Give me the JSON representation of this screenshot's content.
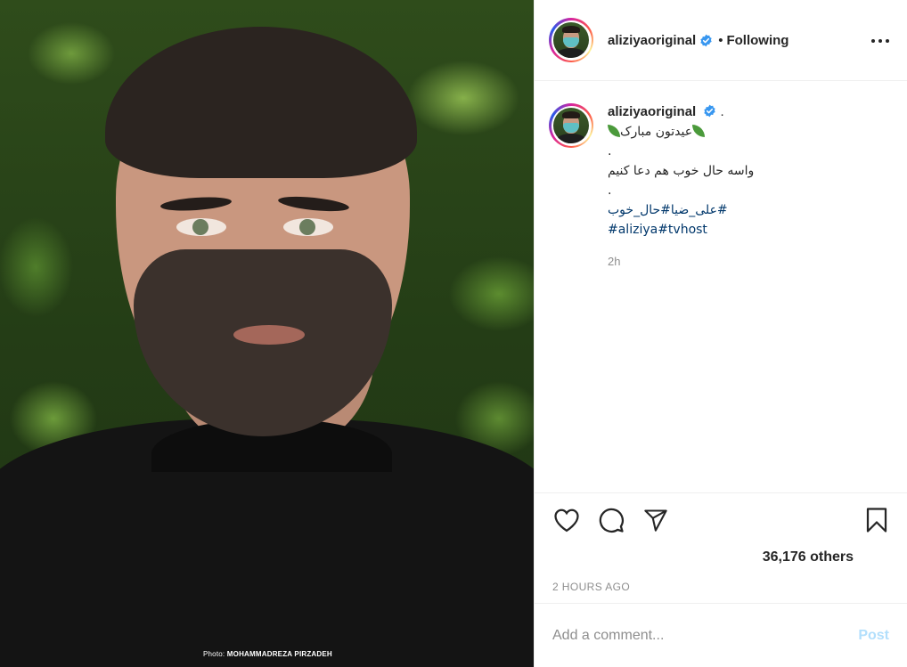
{
  "photo": {
    "credit_prefix": "Photo:",
    "credit_name": "MOHAMMADREZA PIRZADEH"
  },
  "header": {
    "username": "aliziyaoriginal",
    "separator": "•",
    "follow_status": "Following"
  },
  "caption": {
    "username": "aliziyaoriginal",
    "username_suffix": " .",
    "line1": "عیدتون مبارک",
    "line2": ".",
    "line3": "واسه حال خوب هم دعا کنیم",
    "line4": ".",
    "tags1": "#علی_ضیا#حال_خوب",
    "tags2": "#aliziya#tvhost",
    "time": "2h"
  },
  "actions": {
    "likes": "36,176 others",
    "posted_ago": "2 HOURS AGO"
  },
  "comment_box": {
    "placeholder": "Add a comment...",
    "post_label": "Post"
  },
  "icons": {
    "more": "more-options-icon",
    "like": "heart-icon",
    "comment": "comment-icon",
    "share": "paper-plane-icon",
    "save": "bookmark-icon",
    "verified": "verified-badge-icon"
  },
  "colors": {
    "verified": "#3897f0",
    "link": "#00376b",
    "muted": "#8e8e8e",
    "post_disabled": "#b2dffc",
    "text": "#262626"
  }
}
